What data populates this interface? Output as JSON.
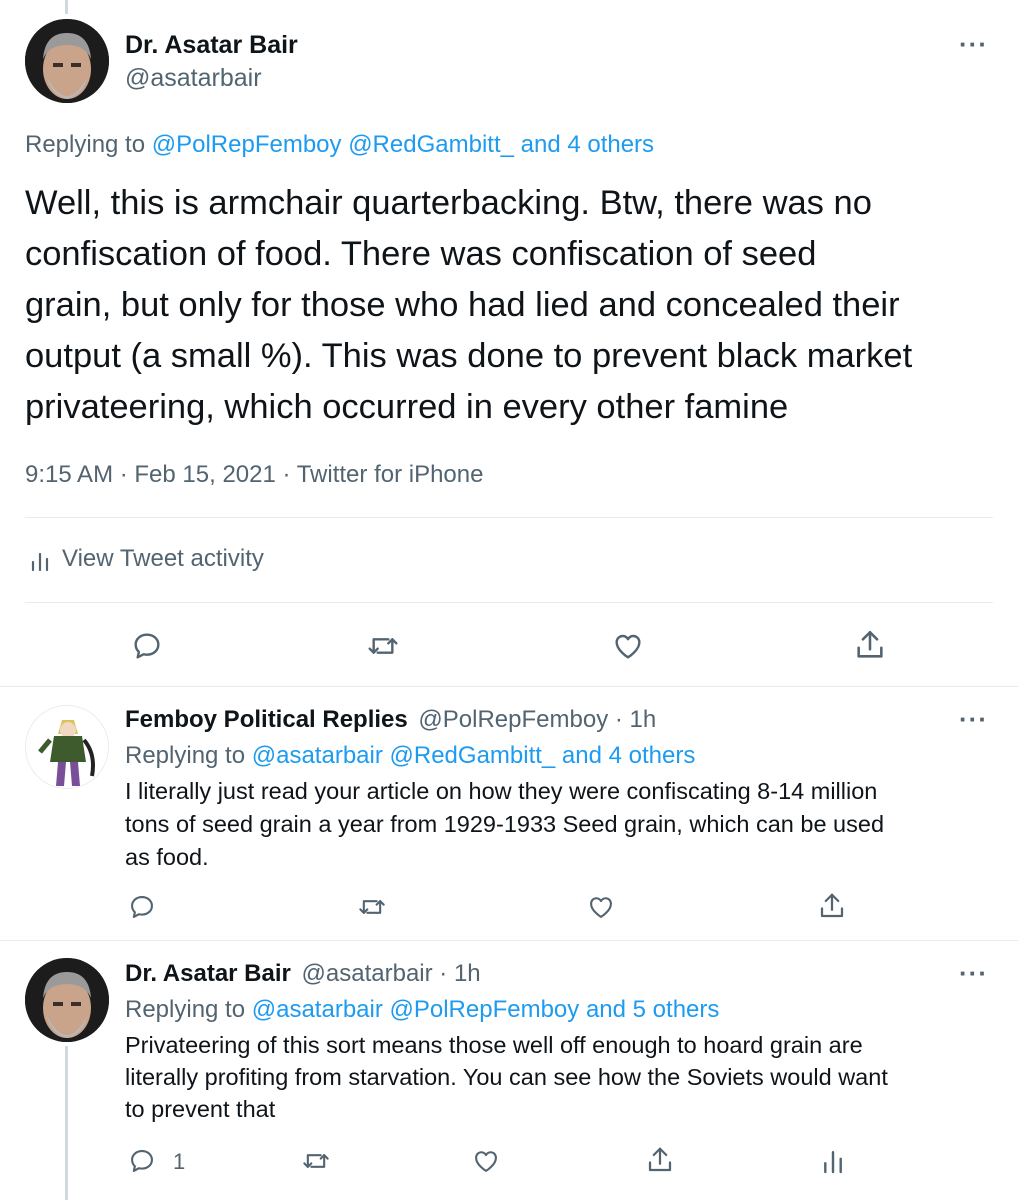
{
  "main_tweet": {
    "author_name": "Dr. Asatar Bair",
    "author_handle": "@asatarbair",
    "reply_prefix": "Replying to",
    "reply_mentions": "@PolRepFemboy @RedGambitt_ and 4 others",
    "text_lines": [
      "Well, this is armchair quarterbacking. Btw, there was no",
      "confiscation of food. There was confiscation of seed",
      "grain, but only for those who had lied and concealed their",
      "output (a small %). This was done to prevent black market",
      "privateering, which occurred in every other famine"
    ],
    "meta": "9:15 AM · Feb 15, 2021 · Twitter for iPhone",
    "activity_label": "View Tweet activity"
  },
  "reply_1": {
    "author_name": "Femboy Political Replies",
    "author_handle_time": "@PolRepFemboy · 1h",
    "reply_prefix": "Replying to",
    "reply_mentions": "@asatarbair @RedGambitt_ and 4 others",
    "text_lines": [
      "I literally just read your article on how they were confiscating 8-14 million",
      "tons of seed grain a year from 1929-1933 Seed grain, which can be used",
      "as food."
    ]
  },
  "reply_2": {
    "author_name": "Dr. Asatar Bair",
    "author_handle_time": "@asatarbair · 1h",
    "reply_prefix": "Replying to",
    "reply_mentions": "@asatarbair @PolRepFemboy and 5 others",
    "text_lines": [
      "Privateering of this sort means those well off enough to hoard grain are",
      "literally profiting from starvation. You can see how the Soviets would want",
      "to prevent that"
    ],
    "reply_count": "1"
  },
  "icons": {
    "more": "more-icon",
    "reply": "reply-icon",
    "retweet": "retweet-icon",
    "like": "like-icon",
    "share": "share-icon",
    "analytics": "analytics-icon"
  },
  "colors": {
    "link": "#1d9bf0",
    "secondary_text": "#536471",
    "divider": "#e6ecf0"
  }
}
